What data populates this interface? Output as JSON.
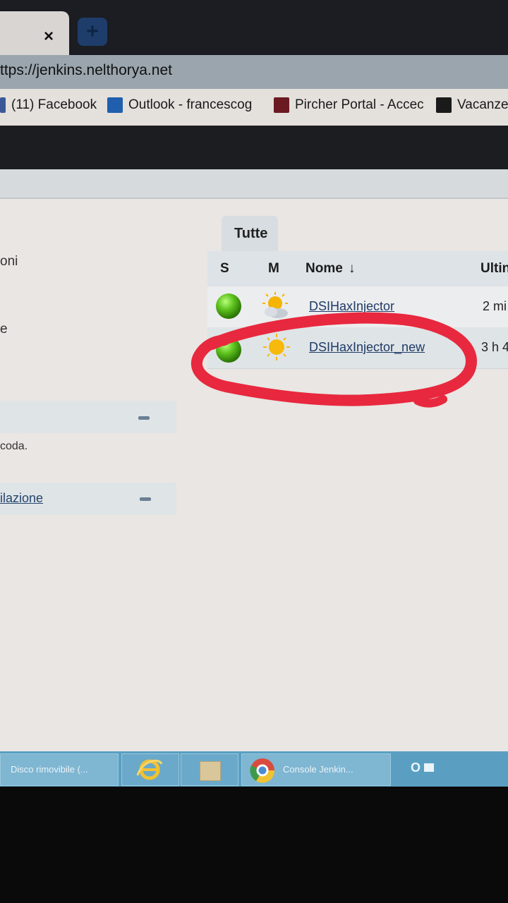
{
  "browser": {
    "tab_close": "×",
    "new_tab": "+",
    "url": "ttps://jenkins.nelthorya.net",
    "bookmarks": [
      {
        "label": "(11) Facebook",
        "icon": "facebook-icon"
      },
      {
        "label": "Outlook - francescog",
        "icon": "outlook-icon"
      },
      {
        "label": "Pircher Portal - Accec",
        "icon": "pircher-icon"
      },
      {
        "label": "Vacanze",
        "icon": "vacanze-icon"
      }
    ]
  },
  "sidebar": {
    "fragment_1": "oni",
    "fragment_2": "e",
    "queue_text": "coda.",
    "build_link": "ilazione"
  },
  "view": {
    "tab_label": "Tutte",
    "columns": {
      "s": "S",
      "m": "M",
      "name": "Nome",
      "sort_arrow": "↓",
      "last": "Ultin"
    },
    "jobs": [
      {
        "name": "DSIHaxInjector",
        "last": "2 mi",
        "status": "success",
        "weather": "partly-cloudy"
      },
      {
        "name": "DSIHaxInjector_new",
        "last": "3 h 4",
        "status": "success",
        "weather": "sunny"
      }
    ]
  },
  "taskbar": {
    "items": [
      {
        "label": "Disco rimovibile (..."
      },
      {
        "label": "Console Jenkin..."
      }
    ],
    "outlook_label": "O"
  },
  "colors": {
    "annotation": "#e8283e",
    "success_ball": "#4caf1a"
  }
}
